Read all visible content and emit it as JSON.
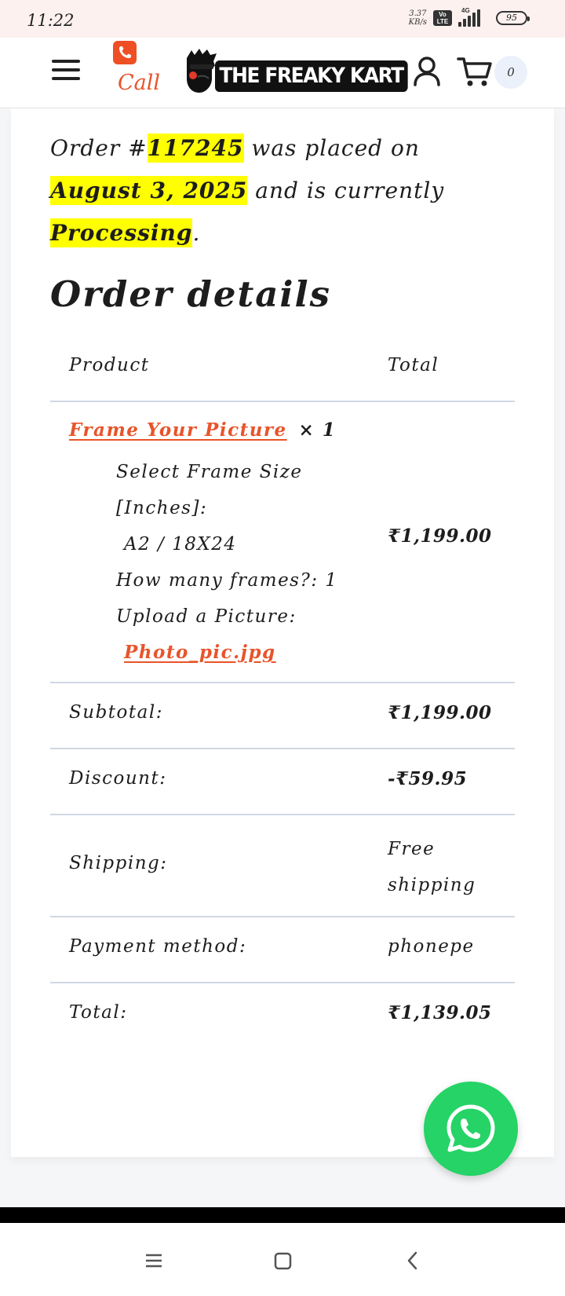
{
  "status_bar": {
    "time": "11:22",
    "net_speed_value": "3.37",
    "net_speed_unit": "KB/s",
    "volte_top": "Vo",
    "volte_bottom": "LTE",
    "network_type": "4G",
    "battery": "95"
  },
  "header": {
    "call_label": "Call",
    "logo_text": "THE FREAKY KART",
    "cart_count": "0"
  },
  "order": {
    "prefix": "Order #",
    "number": "117245",
    "placed_text": " was placed on ",
    "date": "August 3, 2025",
    "status_text": " and is currently ",
    "status": "Processing",
    "period": "."
  },
  "order_details": {
    "title": "Order details",
    "col_product": "Product",
    "col_total": "Total",
    "item": {
      "name": "Frame Your Picture",
      "qty": "× 1",
      "meta_1_label": "Select Frame Size [Inches]:",
      "meta_1_value": "A2 / 18X24",
      "meta_2": "How many frames?: 1",
      "meta_3_label": "Upload a Picture:",
      "meta_3_file": "Photo_pic.jpg",
      "total": "₹1,199.00"
    },
    "subtotal_label": "Subtotal:",
    "subtotal": "₹1,199.00",
    "discount_label": "Discount:",
    "discount": "-₹59.95",
    "shipping_label": "Shipping:",
    "shipping": "Free shipping",
    "payment_label": "Payment method:",
    "payment": "phonepe",
    "total_label": "Total:",
    "total": "₹1,139.05"
  },
  "colors": {
    "accent": "#e8542a",
    "highlight": "#ffff00",
    "whatsapp": "#25d366",
    "divider": "#cfd8e3"
  },
  "icons": [
    "menu-icon",
    "phone-icon",
    "logo-face-icon",
    "user-icon",
    "cart-icon",
    "whatsapp-icon",
    "nav-menu-icon",
    "nav-home-icon",
    "nav-back-icon"
  ]
}
